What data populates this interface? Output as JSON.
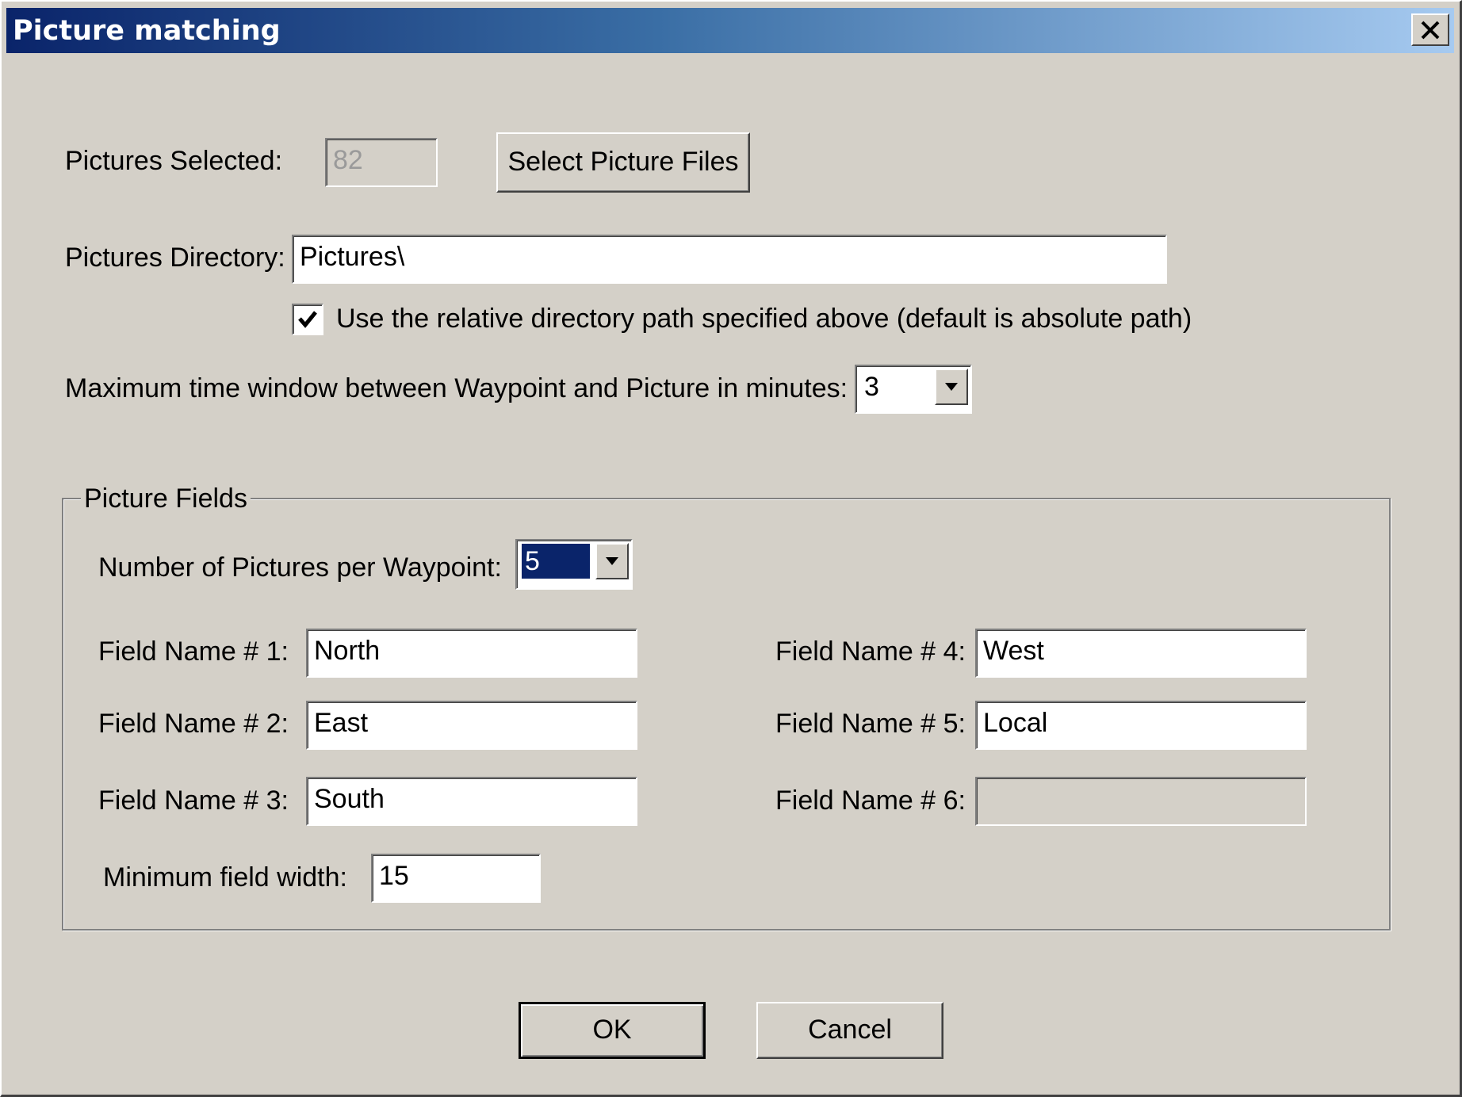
{
  "window": {
    "title": "Picture matching"
  },
  "pictures_selected": {
    "label": "Pictures Selected:",
    "value": "82",
    "select_button": "Select Picture Files"
  },
  "pictures_directory": {
    "label": "Pictures Directory:",
    "value": "Pictures\\",
    "relative_checkbox_label": "Use the relative directory path specified above (default is absolute path)",
    "relative_checked": true
  },
  "time_window": {
    "label": "Maximum time window between Waypoint and Picture in minutes:",
    "value": "3"
  },
  "picture_fields": {
    "legend": "Picture Fields",
    "per_waypoint_label": "Number of Pictures per Waypoint:",
    "per_waypoint_value": "5",
    "fields": [
      {
        "label": "Field Name # 1:",
        "value": "North"
      },
      {
        "label": "Field Name # 2:",
        "value": "East"
      },
      {
        "label": "Field Name # 3:",
        "value": "South"
      },
      {
        "label": "Field Name # 4:",
        "value": "West"
      },
      {
        "label": "Field Name # 5:",
        "value": "Local"
      },
      {
        "label": "Field Name # 6:",
        "value": ""
      }
    ],
    "min_width_label": "Minimum field width:",
    "min_width_value": "15"
  },
  "buttons": {
    "ok": "OK",
    "cancel": "Cancel"
  },
  "colors": {
    "titlebar_start": "#0a246a",
    "titlebar_end": "#a6caf0",
    "dialog_face": "#d4d0c8",
    "selection": "#0a246a"
  }
}
